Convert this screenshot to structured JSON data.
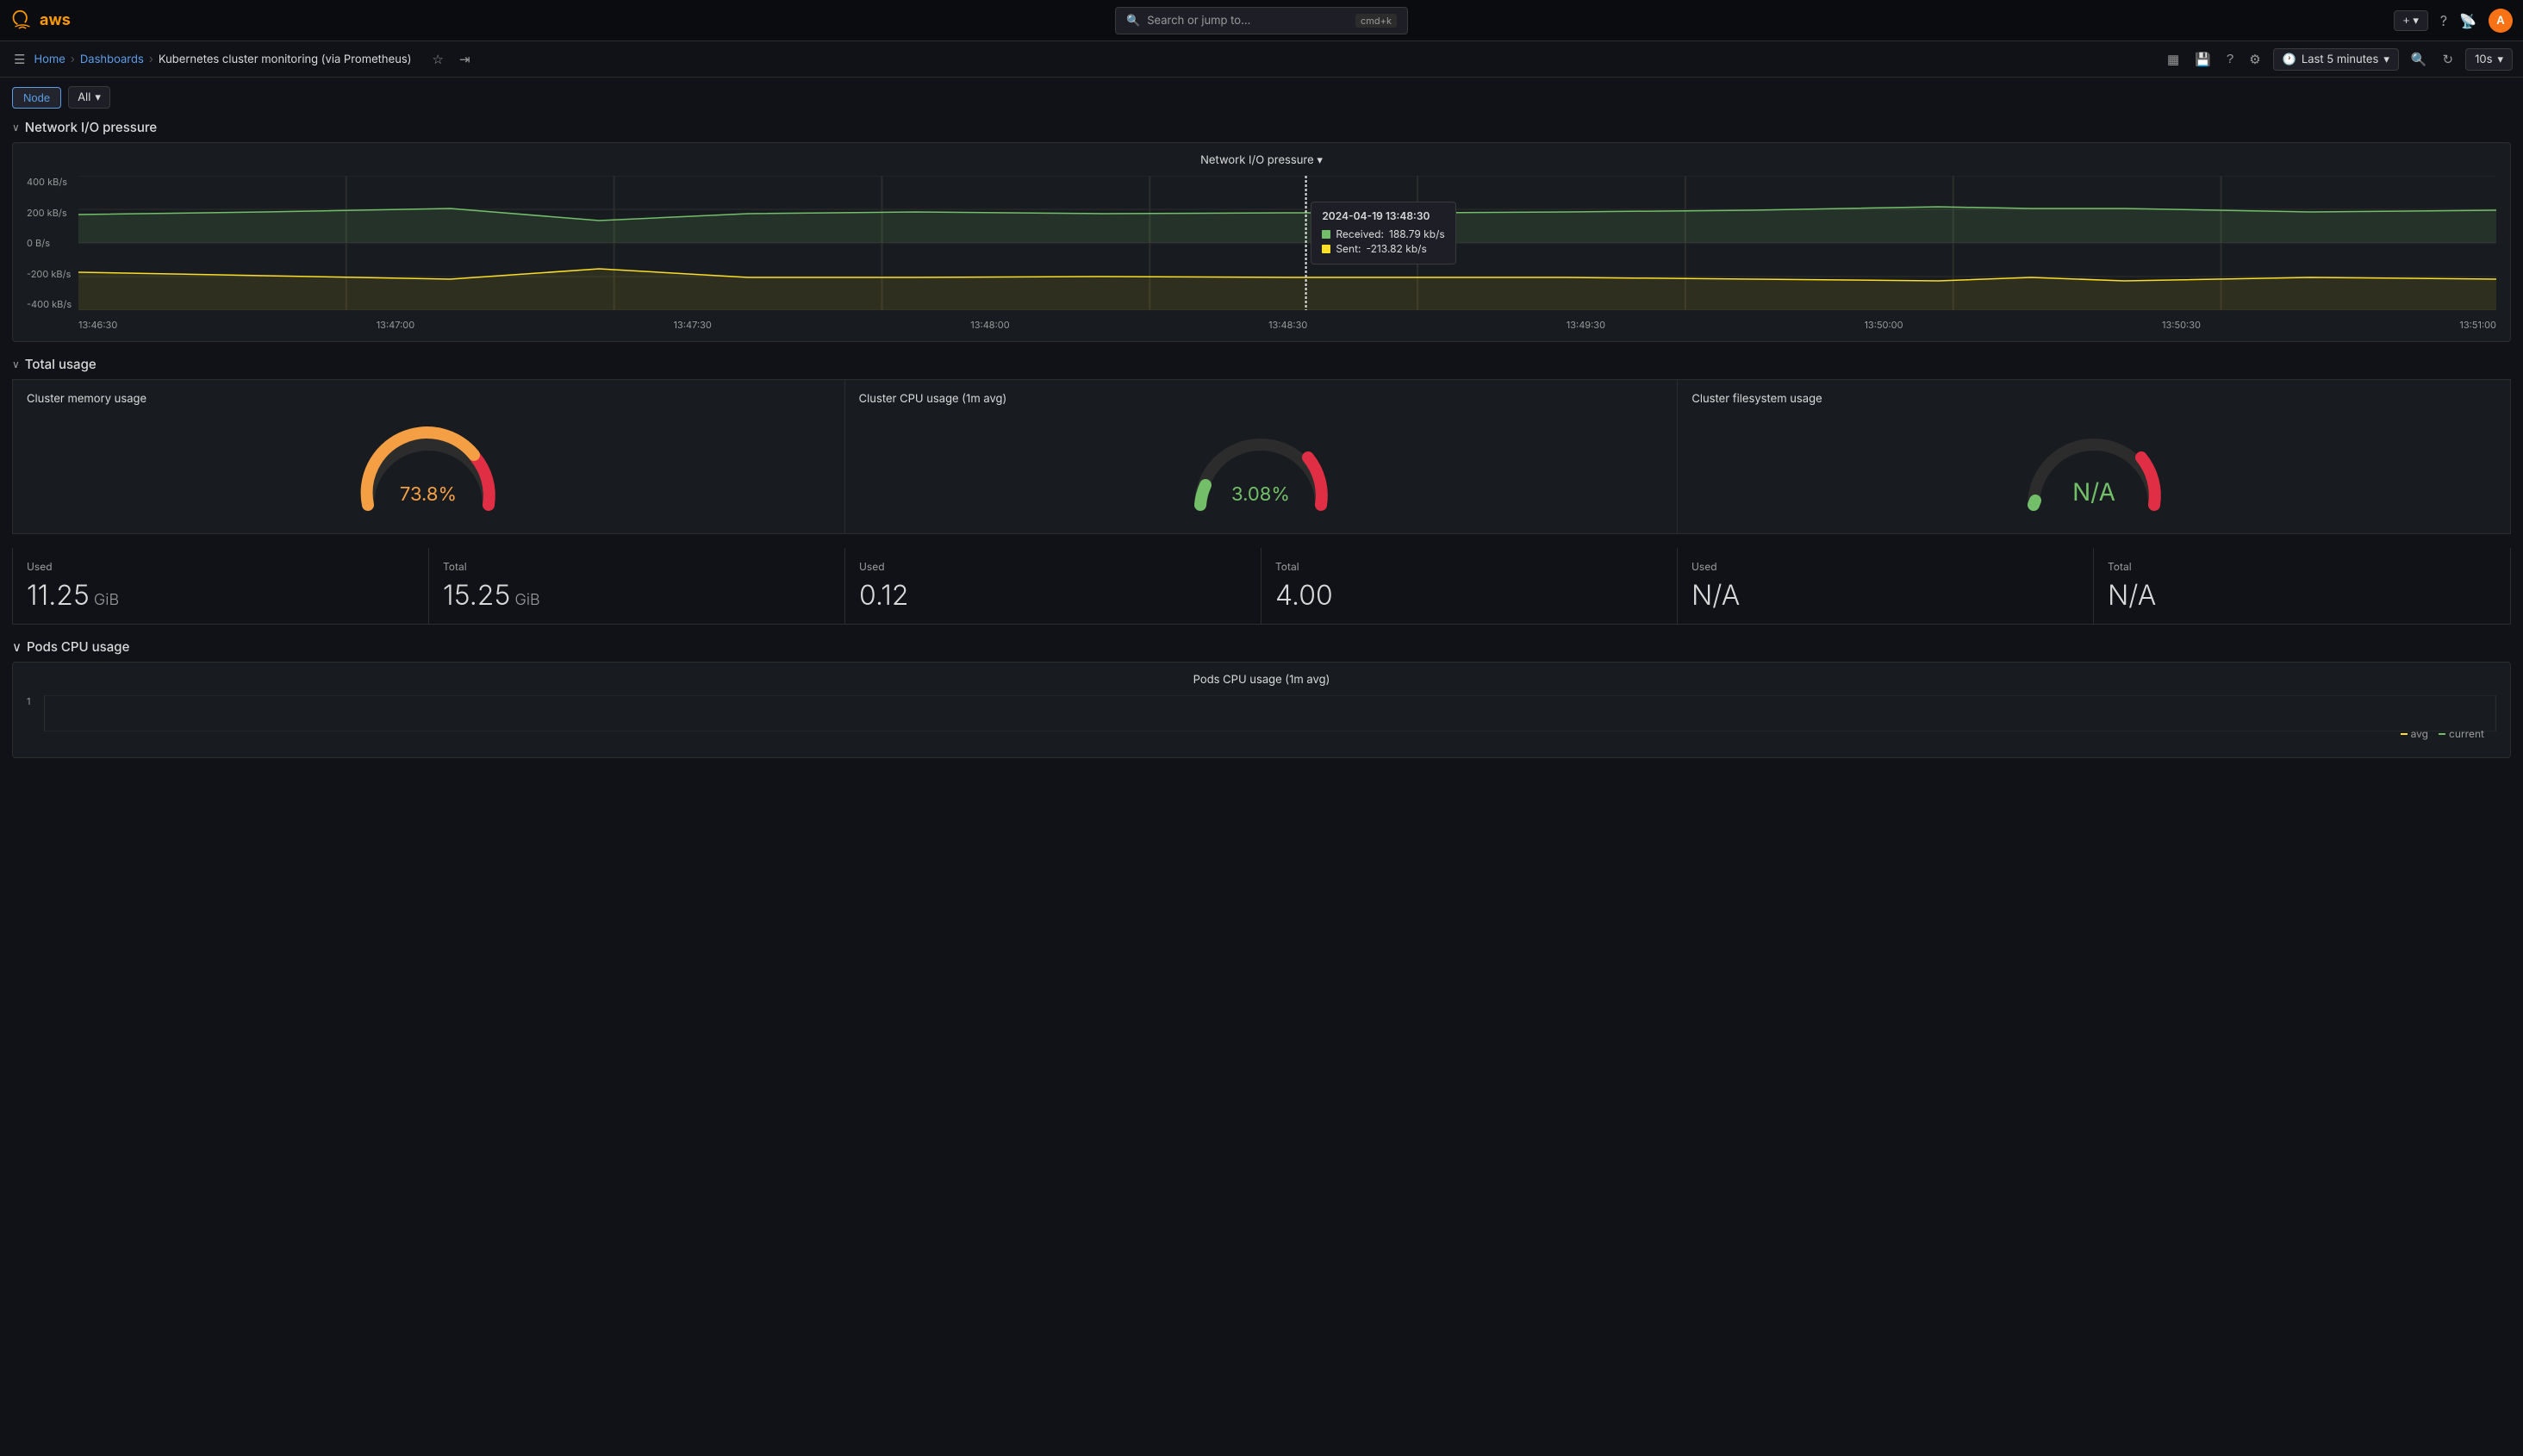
{
  "topbar": {
    "logo_text": "aws",
    "search_placeholder": "Search or jump to...",
    "search_shortcut": "cmd+k",
    "add_label": "+",
    "add_dropdown": "▾",
    "time_range": "Last 5 minutes",
    "refresh_rate": "10s",
    "zoom_icon": "🔍",
    "refresh_icon": "↻",
    "avatar_initials": "A"
  },
  "subnav": {
    "menu_icon": "☰",
    "breadcrumbs": [
      {
        "label": "Home",
        "href": "#"
      },
      {
        "label": "Dashboards",
        "href": "#"
      },
      {
        "label": "Kubernetes cluster monitoring (via Prometheus)",
        "current": true
      }
    ],
    "star_icon": "☆",
    "share_icon": "⇥",
    "bar_chart_icon": "▦",
    "save_icon": "💾",
    "help_icon": "?",
    "settings_icon": "⚙"
  },
  "filters": {
    "node_label": "Node",
    "all_label": "All",
    "all_dropdown_arrow": "▾"
  },
  "network_section": {
    "title": "Network I/O pressure",
    "chevron": "∨",
    "chart_title": "Network I/O pressure ▾",
    "y_axis": [
      "400 kB/s",
      "200 kB/s",
      "0 B/s",
      "-200 kB/s",
      "-400 kB/s"
    ],
    "x_axis": [
      "13:46:30",
      "13:47:00",
      "13:47:30",
      "13:48:00",
      "13:48:30",
      "13:49:30",
      "13:50:00",
      "13:50:30",
      "13:51:00"
    ],
    "tooltip": {
      "date": "2024-04-19 13:48:30",
      "received_label": "Received:",
      "received_value": "188.79 kb/s",
      "sent_label": "Sent:",
      "sent_value": "-213.82 kb/s",
      "received_color": "#73bf69",
      "sent_color": "#fade2a"
    }
  },
  "total_usage": {
    "title": "Total usage",
    "chevron": "∨",
    "cards": [
      {
        "title": "Cluster memory usage",
        "gauge_value": "73.8%",
        "gauge_color": "#f59f45",
        "gauge_pct": 73.8
      },
      {
        "title": "Cluster CPU usage (1m avg)",
        "gauge_value": "3.08%",
        "gauge_color": "#73bf69",
        "gauge_pct": 3.08
      },
      {
        "title": "Cluster filesystem usage",
        "gauge_value": "N/A",
        "gauge_color": "#73bf69",
        "gauge_pct": 0
      }
    ],
    "stats": [
      {
        "label": "Used",
        "value": "11.25",
        "unit": " GiB"
      },
      {
        "label": "Total",
        "value": "15.25",
        "unit": " GiB"
      },
      {
        "label": "Used",
        "value": "0.12",
        "unit": ""
      },
      {
        "label": "Total",
        "value": "4.00",
        "unit": ""
      },
      {
        "label": "Used",
        "value": "N/A",
        "unit": ""
      },
      {
        "label": "Total",
        "value": "N/A",
        "unit": ""
      }
    ]
  },
  "pods_section": {
    "title": "Pods CPU usage",
    "chevron": "∨",
    "chart_title": "Pods CPU usage (1m avg)",
    "y_label": "1",
    "legend": [
      {
        "label": "avg",
        "color": "#fade2a"
      },
      {
        "label": "current",
        "color": "#73bf69"
      }
    ]
  }
}
